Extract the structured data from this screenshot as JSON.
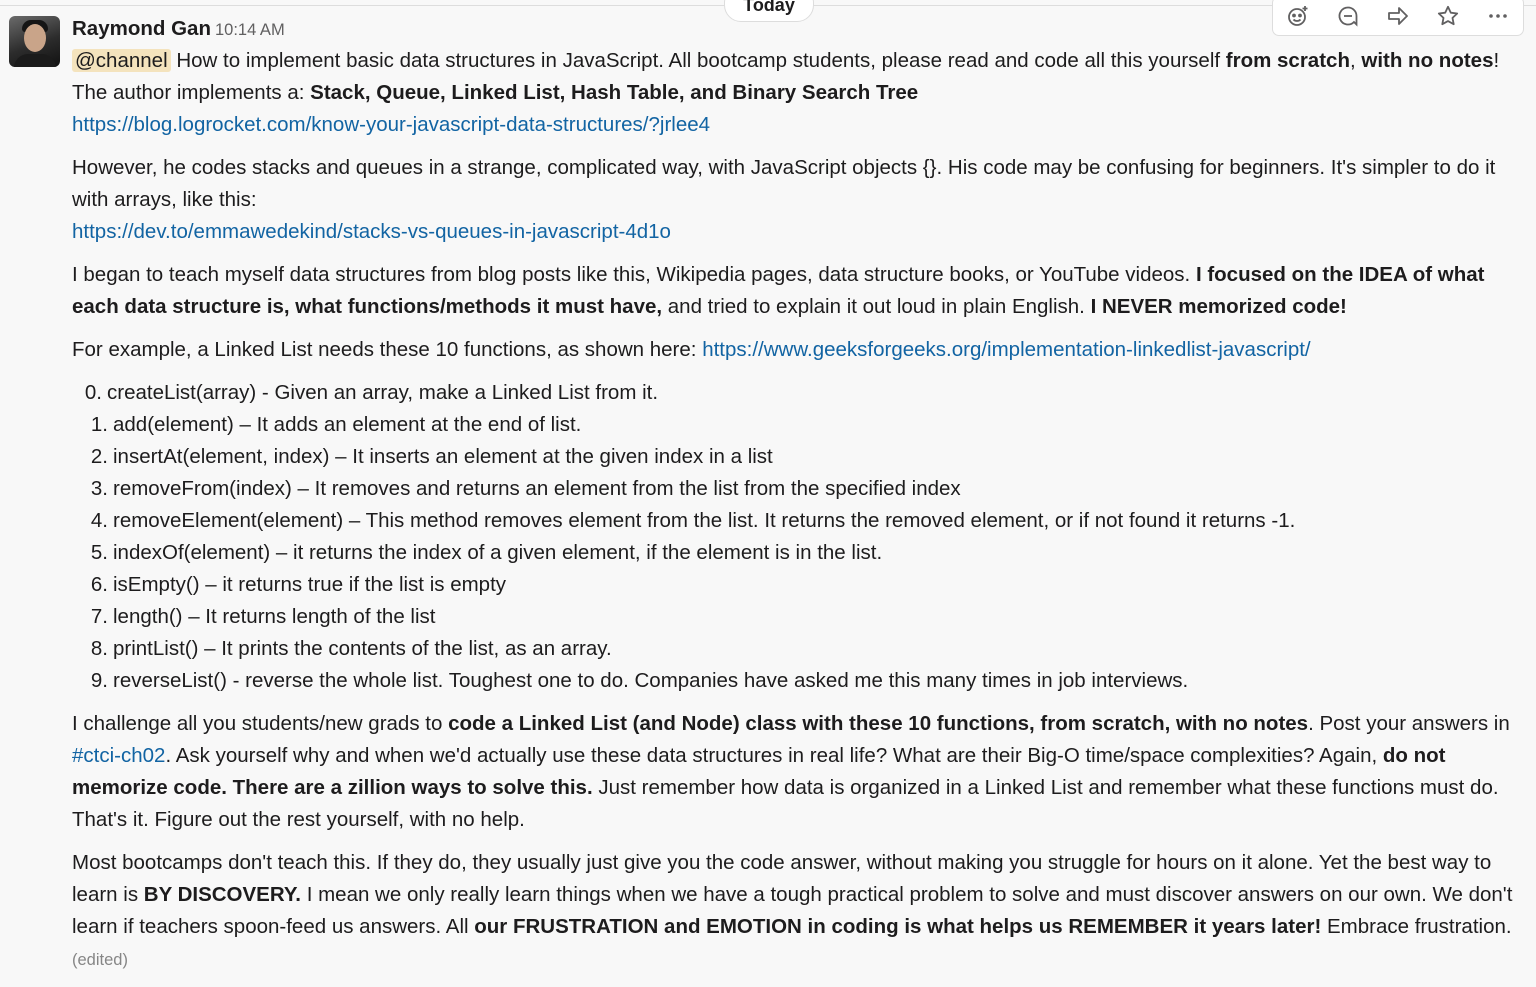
{
  "divider": {
    "label": "Today"
  },
  "actions": [
    {
      "name": "add-reaction-icon"
    },
    {
      "name": "reply-in-thread-icon"
    },
    {
      "name": "share-message-icon"
    },
    {
      "name": "save-star-icon"
    },
    {
      "name": "more-actions-icon"
    }
  ],
  "message": {
    "sender": "Raymond Gan",
    "time": "10:14 AM",
    "p1": {
      "mention": "@channel",
      "t1": " How to implement basic data structures in JavaScript. All bootcamp students, please read and code all this yourself ",
      "b1": "from scratch",
      "t2": ", ",
      "b2": "with no notes",
      "t3": "! The author implements a: ",
      "b3": "Stack, Queue, Linked List, Hash Table, and Binary Search Tree",
      "link": "https://blog.logrocket.com/know-your-javascript-data-structures/?jrlee4"
    },
    "p2": {
      "text": "However, he codes stacks and queues in a strange, complicated way, with JavaScript objects {}. His code may be confusing for beginners. It's simpler to do it with arrays, like this:",
      "link": "https://dev.to/emmawedekind/stacks-vs-queues-in-javascript-4d1o"
    },
    "p3": {
      "t1": "I began to teach myself data structures from blog posts like this, Wikipedia pages, data structure books, or YouTube videos. ",
      "b1": "I focused on the IDEA of what each data structure is, what functions/methods it must have,",
      "t2": " and tried to explain it out loud in plain English. ",
      "b2": "I NEVER memorized code!"
    },
    "p4": {
      "text": "For example, a Linked List needs these 10 functions, as shown here: ",
      "link": "https://www.geeksforgeeks.org/implementation-linkedlist-javascript/"
    },
    "list": [
      {
        "num": "0.",
        "text": "createList(array) - Given an array, make a Linked List from it."
      },
      {
        "num": "1.",
        "text": "add(element) – It adds an element at the end of list."
      },
      {
        "num": "2.",
        "text": "insertAt(element, index) – It inserts an element at the given index in a list"
      },
      {
        "num": "3.",
        "text": "removeFrom(index) – It removes and returns an element from the list from the specified index"
      },
      {
        "num": "4.",
        "text": "removeElement(element) – This method removes element from the list. It returns the removed element, or if not found it returns -1."
      },
      {
        "num": "5.",
        "text": "indexOf(element) – it returns the index of a given element, if the element is in the list."
      },
      {
        "num": "6.",
        "text": "isEmpty() – it returns true if the list is empty"
      },
      {
        "num": "7.",
        "text": "length() – It returns length of the list"
      },
      {
        "num": "8.",
        "text": "printList() – It prints the contents of the list, as an array."
      },
      {
        "num": "9.",
        "text": "reverseList() - reverse the whole list. Toughest one to do. Companies have asked me this many times in job interviews."
      }
    ],
    "p5": {
      "t1": "I challenge all you students/new grads to ",
      "b1": "code a Linked List (and Node) class with these 10 functions, from scratch, with no notes",
      "t2": ". Post your answers in ",
      "channel": "#ctci-ch02",
      "t3": ". Ask yourself why and when we'd actually use these data structures in real life? What are their Big-O time/space complexities? Again, ",
      "b2": "do not memorize code. There are a zillion ways to solve this.",
      "t4": " Just remember how data is organized in a Linked List and remember what these functions must do. That's it. Figure out the rest yourself, with no help."
    },
    "p6": {
      "t1": "Most bootcamps don't teach this. If they do, they usually just give you the code answer, without making you struggle for hours on it alone. Yet the best way to learn is ",
      "b1": "BY DISCOVERY.",
      "t2": " I mean we only really learn things when we have a tough practical problem to solve and must discover answers on our own. We don't learn if teachers spoon-feed us answers. All ",
      "b2": "our FRUSTRATION and EMOTION in coding is what helps us REMEMBER it years later!",
      "t3": " Embrace frustration. ",
      "edited": "(edited)"
    }
  }
}
